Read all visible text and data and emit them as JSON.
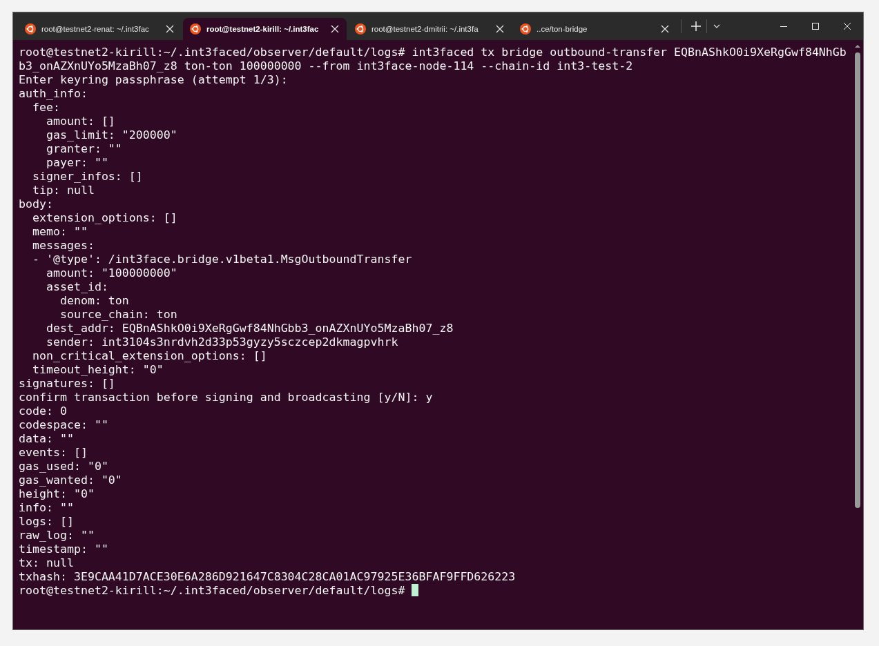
{
  "tabs": [
    {
      "label": "root@testnet2-renat: ~/.int3fac",
      "selected": false
    },
    {
      "label": "root@testnet2-kirill: ~/.int3fac",
      "selected": true
    },
    {
      "label": "root@testnet2-dmitrii: ~/.int3fa",
      "selected": false
    },
    {
      "label": "..ce/ton-bridge",
      "selected": false
    }
  ],
  "terminal": {
    "lines": [
      "root@testnet2-kirill:~/.int3faced/observer/default/logs# int3faced tx bridge outbound-transfer EQBnAShkO0i9XeRgGwf84NhGb",
      "b3_onAZXnUYo5MzaBh07_z8 ton-ton 100000000 --from int3face-node-114 --chain-id int3-test-2",
      "Enter keyring passphrase (attempt 1/3):",
      "auth_info:",
      "  fee:",
      "    amount: []",
      "    gas_limit: \"200000\"",
      "    granter: \"\"",
      "    payer: \"\"",
      "  signer_infos: []",
      "  tip: null",
      "body:",
      "  extension_options: []",
      "  memo: \"\"",
      "  messages:",
      "  - '@type': /int3face.bridge.v1beta1.MsgOutboundTransfer",
      "    amount: \"100000000\"",
      "    asset_id:",
      "      denom: ton",
      "      source_chain: ton",
      "    dest_addr: EQBnAShkO0i9XeRgGwf84NhGbb3_onAZXnUYo5MzaBh07_z8",
      "    sender: int3104s3nrdvh2d33p53gyzy5sczcep2dkmagpvhrk",
      "  non_critical_extension_options: []",
      "  timeout_height: \"0\"",
      "signatures: []",
      "confirm transaction before signing and broadcasting [y/N]: y",
      "code: 0",
      "codespace: \"\"",
      "data: \"\"",
      "events: []",
      "gas_used: \"0\"",
      "gas_wanted: \"0\"",
      "height: \"0\"",
      "info: \"\"",
      "logs: []",
      "raw_log: \"\"",
      "timestamp: \"\"",
      "tx: null",
      "txhash: 3E9CAA41D7ACE30E6A286D921647C8304C28CA01AC97925E36BFAF9FFD626223",
      "root@testnet2-kirill:~/.int3faced/observer/default/logs# "
    ],
    "cursor": true
  }
}
